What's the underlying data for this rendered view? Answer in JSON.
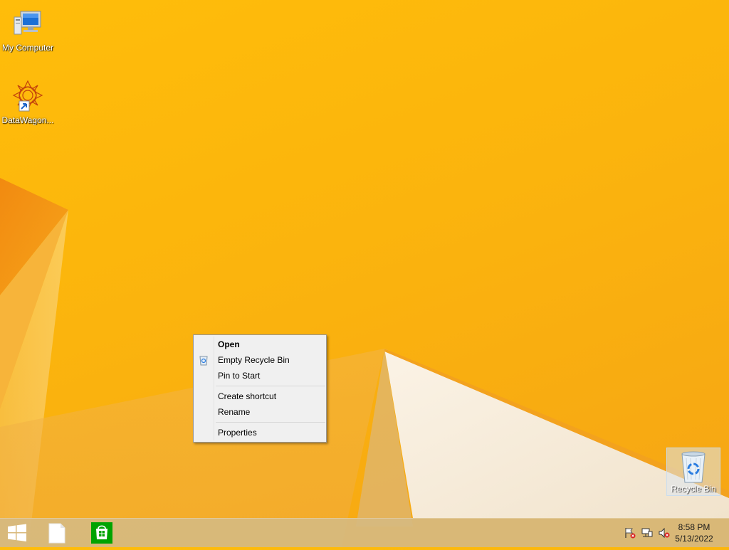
{
  "desktop": {
    "icons": [
      {
        "label": "My Computer",
        "icon": "computer-icon"
      },
      {
        "label": "DataWagon...",
        "icon": "datawagon-icon"
      }
    ],
    "recycle_bin": {
      "label": "Recycle Bin",
      "icon": "recycle-bin-icon"
    }
  },
  "context_menu": {
    "items": [
      {
        "label": "Open",
        "bold": true
      },
      {
        "label": "Empty Recycle Bin",
        "icon": "recycle-bin-small-icon"
      },
      {
        "label": "Pin to Start"
      },
      {
        "label": "Create shortcut"
      },
      {
        "label": "Rename"
      },
      {
        "label": "Properties"
      }
    ]
  },
  "taskbar": {
    "buttons": [
      {
        "name": "start-button",
        "icon": "windows-logo-icon"
      },
      {
        "name": "file-explorer-button",
        "icon": "document-icon"
      },
      {
        "name": "store-button",
        "icon": "store-icon"
      }
    ],
    "tray": {
      "icons": [
        "action-center-flag-icon",
        "network-icon",
        "volume-muted-icon"
      ],
      "time": "8:58 PM",
      "date": "5/13/2022"
    }
  },
  "colors": {
    "wallpaper": "#fbb40d",
    "store_green": "#00a300",
    "windows_blue": "#0078d7"
  }
}
